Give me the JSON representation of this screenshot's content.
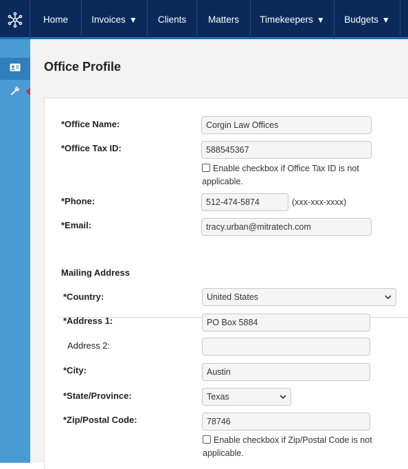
{
  "nav": {
    "items": [
      {
        "label": "Home",
        "has_caret": false
      },
      {
        "label": "Invoices",
        "has_caret": true
      },
      {
        "label": "Clients",
        "has_caret": false
      },
      {
        "label": "Matters",
        "has_caret": false
      },
      {
        "label": "Timekeepers",
        "has_caret": true
      },
      {
        "label": "Budgets",
        "has_caret": true
      }
    ],
    "caret_glyph": "▼",
    "logo_icon": "network-hub-icon"
  },
  "rail": {
    "items": [
      {
        "icon": "id-card-icon",
        "active": true
      },
      {
        "icon": "wrench-icon",
        "active": false
      }
    ]
  },
  "annotation": {
    "icon": "red-arrow-left-icon",
    "color": "#e02020"
  },
  "page": {
    "title": "Office Profile"
  },
  "form": {
    "office_name": {
      "label": "*Office Name:",
      "value": "Corgin Law Offices"
    },
    "office_tax_id": {
      "label": "*Office Tax ID:",
      "value": "588545367",
      "na_checkbox": "Enable checkbox if Office Tax ID is not applicable."
    },
    "phone": {
      "label": "*Phone:",
      "value": "512-474-5874",
      "hint": "(xxx-xxx-xxxx)"
    },
    "email": {
      "label": "*Email:",
      "value": "tracy.urban@mitratech.com"
    }
  },
  "mailing": {
    "section_title": "Mailing Address",
    "country": {
      "label": "*Country:",
      "value": "United States"
    },
    "address1": {
      "label": "*Address 1:",
      "value": "PO Box 5884"
    },
    "address2": {
      "label": "Address 2:",
      "value": ""
    },
    "city": {
      "label": "*City:",
      "value": "Austin"
    },
    "state": {
      "label": "*State/Province:",
      "value": "Texas"
    },
    "zip": {
      "label": "*Zip/Postal Code:",
      "value": "78746",
      "na_checkbox": "Enable checkbox if Zip/Postal Code is not applicable."
    }
  },
  "colors": {
    "nav_bg": "#0b2a5c",
    "rail_bg": "#4a9bd4",
    "accent": "#1f6fbf"
  }
}
